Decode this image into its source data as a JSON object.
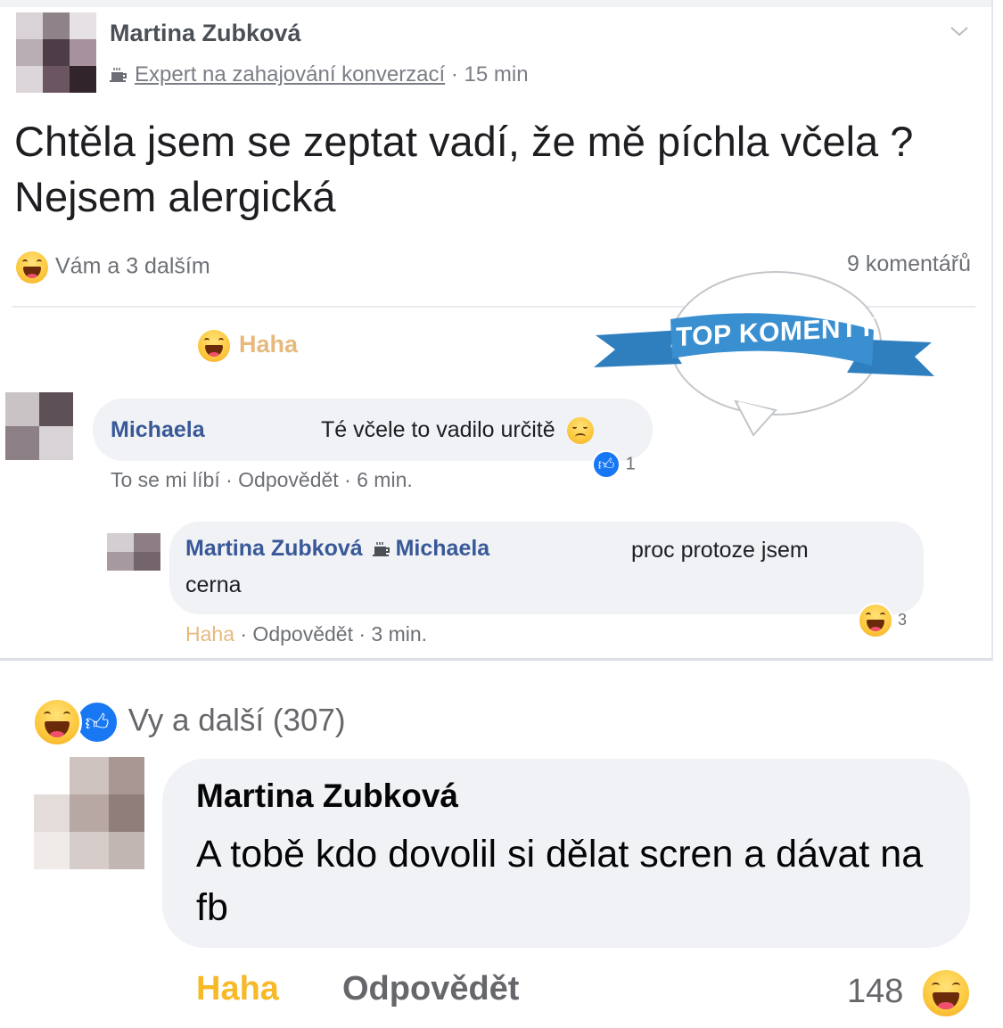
{
  "post": {
    "author": "Martina Zubková",
    "badge": "Expert na zahajování konverzací",
    "time": "· 15 min",
    "text": "Chtěla jsem se zeptat vadí, že mě píchla včela ? Nejsem alergická",
    "reactions_text": "Vám a 3 dalším",
    "comments_count": "9 komentářů",
    "action_label": "Haha"
  },
  "comment1": {
    "author": "Michaela",
    "text": "Té včele to vadilo určitě",
    "meta": "To se mi líbí · Odpovědět · 6 min.",
    "reaction_count": "1"
  },
  "comment2": {
    "author": "Martina Zubková",
    "mention": "Michaela",
    "text_line1": "proc protoze jsem",
    "text_line2": "cerna",
    "meta_reaction": "Haha",
    "meta_rest": " · Odpovědět · 3 min.",
    "reaction_count": "3"
  },
  "logo": {
    "text": "TOP KOMENTY.SK"
  },
  "bottom": {
    "reactions_text": "Vy a další (307)",
    "author": "Martina Zubková",
    "text": "A tobě kdo dovolil si dělat scren a dávat na fb",
    "haha_label": "Haha",
    "reply_label": "Odpovědět",
    "reaction_count": "148"
  },
  "colors": {
    "link": "#385898",
    "haha": "#f7b928",
    "like": "#1877f2",
    "logo_ribbon": "#3a8fd1"
  }
}
